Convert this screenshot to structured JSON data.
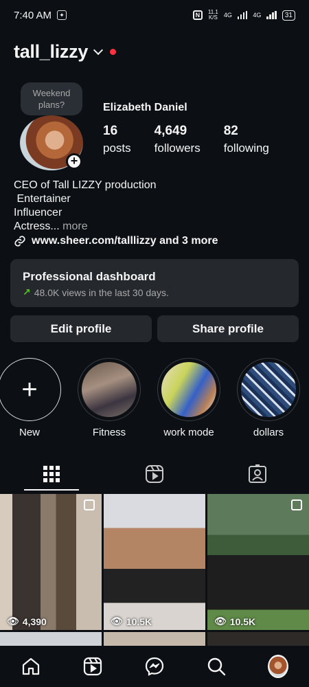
{
  "status_bar": {
    "time": "7:40 AM",
    "speed_top": "11.1",
    "speed_bottom": "K/S",
    "net1": "4G",
    "net2": "4G",
    "battery": "31"
  },
  "profile": {
    "username": "tall_lizzy",
    "note": "Weekend plans?",
    "full_name": "Elizabeth Daniel",
    "stats": [
      {
        "value": "16",
        "label": "posts"
      },
      {
        "value": "4,649",
        "label": "followers"
      },
      {
        "value": "82",
        "label": "following"
      }
    ],
    "bio_lines": [
      "CEO of Tall LIZZY production",
      " Entertainer",
      "Influencer",
      "Actress..."
    ],
    "bio_more": "more",
    "link": "www.sheer.com/talllizzy and 3 more"
  },
  "dashboard": {
    "title": "Professional dashboard",
    "subtitle": "48.0K views in the last 30 days."
  },
  "buttons": {
    "edit": "Edit profile",
    "share": "Share profile"
  },
  "highlights": [
    {
      "label": "New"
    },
    {
      "label": "Fitness"
    },
    {
      "label": "work mode"
    },
    {
      "label": "dollars"
    }
  ],
  "tabs": [
    "grid-icon",
    "reels-icon",
    "tagged-icon"
  ],
  "posts": [
    {
      "views": "4,390"
    },
    {
      "views": "10.5K"
    },
    {
      "views": "10.5K"
    }
  ],
  "nav": [
    "home-icon",
    "reels-icon",
    "messenger-icon",
    "search-icon",
    "profile-avatar"
  ],
  "colors": {
    "background": "#0c1014",
    "card": "#25292e",
    "accent_red": "#ff3040",
    "trend_green": "#58c322"
  }
}
